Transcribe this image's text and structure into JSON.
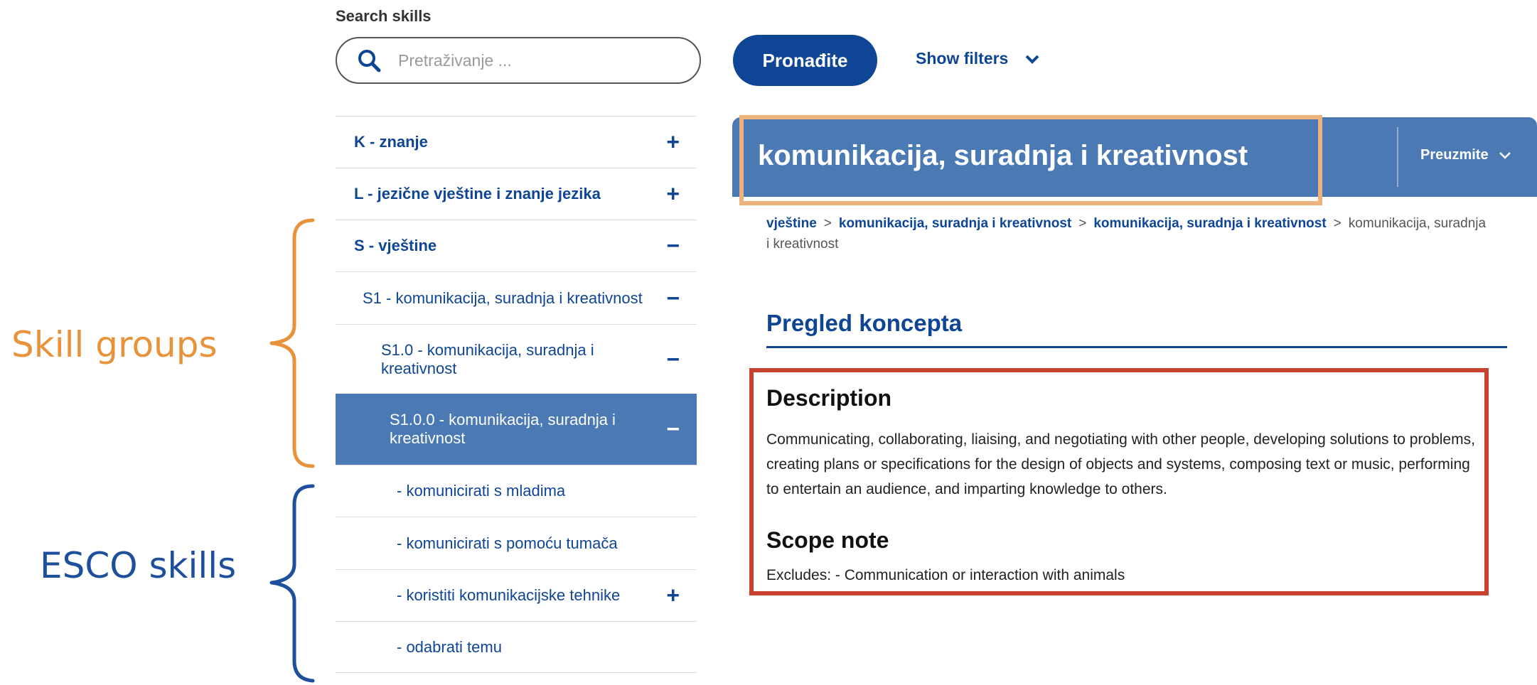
{
  "annotations": {
    "skill_groups_label": "Skill groups",
    "skill_groups_color": "#e8923a",
    "esco_skills_label": "ESCO skills",
    "esco_skills_color": "#1e4f9c"
  },
  "search": {
    "heading": "Search skills",
    "placeholder": "Pretraživanje ...",
    "find_button": "Pronađite",
    "show_filters": "Show filters"
  },
  "tree": [
    {
      "code": "K",
      "label": " - znanje",
      "toggle": "+"
    },
    {
      "code": "L",
      "label": " - jezične vještine i znanje jezika",
      "toggle": "+"
    },
    {
      "code": "S",
      "label": " - vještine",
      "toggle": "−"
    },
    {
      "code": "",
      "label": "S1 - komunikacija, suradnja i kreativnost",
      "toggle": "−"
    },
    {
      "code": "",
      "label": "S1.0 - komunikacija, suradnja i kreativnost",
      "toggle": "−"
    },
    {
      "code": "",
      "label": "S1.0.0 - komunikacija, suradnja i kreativnost",
      "toggle": "−",
      "selected": true
    },
    {
      "code": "",
      "label": "- komunicirati s mladima",
      "toggle": ""
    },
    {
      "code": "",
      "label": "- komunicirati s pomoću tumača",
      "toggle": ""
    },
    {
      "code": "",
      "label": "- koristiti komunikacijske tehnike",
      "toggle": "+"
    },
    {
      "code": "",
      "label": "- odabrati temu",
      "toggle": ""
    }
  ],
  "concept": {
    "title": "komunikacija, suradnja i kreativnost",
    "download": "Preuzmite",
    "breadcrumb": [
      "vještine",
      "komunikacija, suradnja i kreativnost",
      "komunikacija, suradnja i kreativnost"
    ],
    "breadcrumb_current": "komunikacija, suradnja i kreativnost",
    "section_title": "Pregled koncepta",
    "description_heading": "Description",
    "description_text": "Communicating, collaborating, liaising, and negotiating with other people, developing solutions to problems, creating plans or specifications for the design of objects and systems, composing text or music, performing to entertain an audience, and imparting knowledge to others.",
    "scope_heading": "Scope note",
    "scope_text": "Excludes: - Communication or interaction with animals"
  },
  "colors": {
    "primary": "#0e4595",
    "header_blue": "#4a79b3",
    "title_highlight": "#f0b27d",
    "description_highlight": "#c8432f"
  }
}
